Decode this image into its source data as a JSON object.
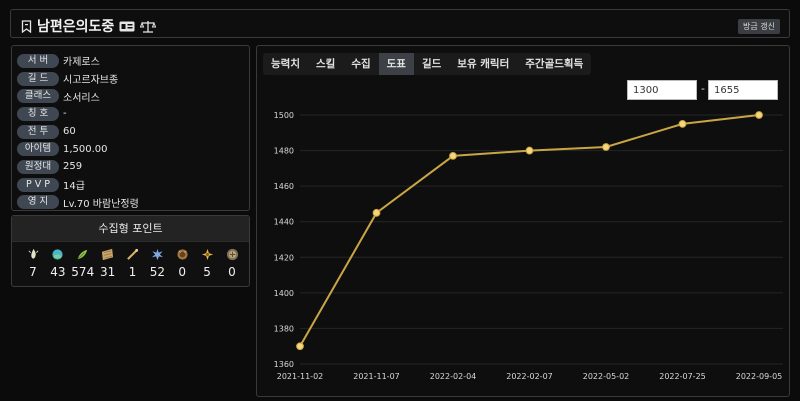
{
  "header": {
    "title": "남편은의도중",
    "refresh_label": "방금 갱신"
  },
  "info": [
    {
      "key": "서 버",
      "value": "카제로스"
    },
    {
      "key": "길 드",
      "value": "시고르자브종"
    },
    {
      "key": "클래스",
      "value": "소서리스"
    },
    {
      "key": "칭 호",
      "value": "-"
    },
    {
      "key": "전 투",
      "value": "60"
    },
    {
      "key": "아이템",
      "value": "1,500.00"
    },
    {
      "key": "원정대",
      "value": "259"
    },
    {
      "key": "P V P",
      "value": "14급"
    },
    {
      "key": "영 지",
      "value": "Lv.70 바람난정령"
    }
  ],
  "collection": {
    "title": "수집형 포인트",
    "items": [
      {
        "icon": "mokoko-seed-icon",
        "value": "7"
      },
      {
        "icon": "island-heart-icon",
        "value": "43"
      },
      {
        "icon": "world-tree-leaf-icon",
        "value": "574"
      },
      {
        "icon": "masterpiece-icon",
        "value": "31"
      },
      {
        "icon": "adventure-tome-icon",
        "value": "1"
      },
      {
        "icon": "giant-heart-icon",
        "value": "52"
      },
      {
        "icon": "ignea-token-icon",
        "value": "0"
      },
      {
        "icon": "sea-bounty-icon",
        "value": "5"
      },
      {
        "icon": "orpheus-star-icon",
        "value": "0"
      }
    ]
  },
  "tabs": [
    {
      "label": "능력치",
      "active": false
    },
    {
      "label": "스킬",
      "active": false
    },
    {
      "label": "수집",
      "active": false
    },
    {
      "label": "도표",
      "active": true
    },
    {
      "label": "길드",
      "active": false
    },
    {
      "label": "보유 캐릭터",
      "active": false
    },
    {
      "label": "주간골드획득",
      "active": false
    }
  ],
  "range": {
    "min": "1300",
    "max": "1655",
    "separator": "-"
  },
  "colors": {
    "line": "#c9a544",
    "point": "#f5d77a",
    "accent": "#3d4046"
  },
  "chart_data": {
    "type": "line",
    "x": [
      "2021-11-02",
      "2021-11-07",
      "2022-02-04",
      "2022-02-07",
      "2022-05-02",
      "2022-07-25",
      "2022-09-05"
    ],
    "series": [
      {
        "values": [
          1370,
          1445,
          1477,
          1480,
          1482,
          1495,
          1500
        ]
      }
    ],
    "ylim": [
      1360,
      1500
    ],
    "yticks": [
      1360,
      1380,
      1400,
      1420,
      1440,
      1460,
      1480,
      1500
    ],
    "grid": true,
    "title": "",
    "xlabel": "",
    "ylabel": ""
  }
}
